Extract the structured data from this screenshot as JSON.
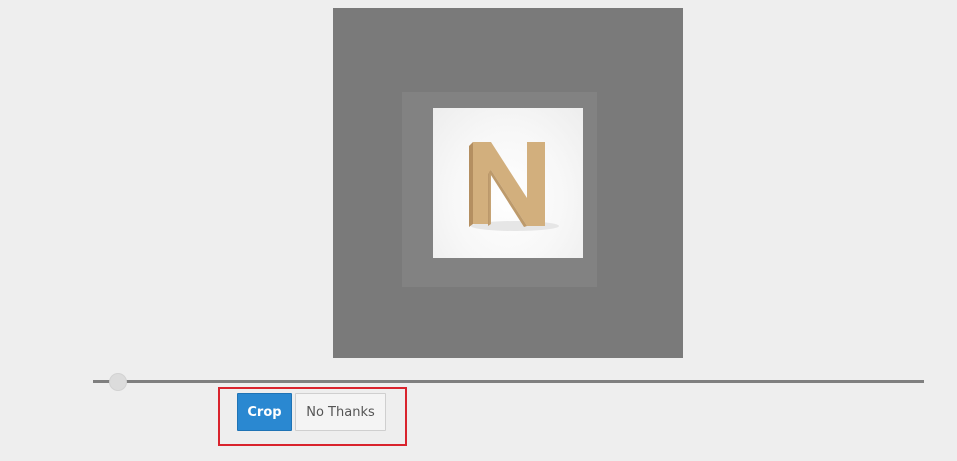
{
  "cropper": {
    "preview_letter": "N",
    "zoom": {
      "level": 0.03
    }
  },
  "actions": {
    "crop_label": "Crop",
    "cancel_label": "No Thanks"
  },
  "colors": {
    "primary": "#2a88d1",
    "highlight": "#d9232d",
    "letter": "#d2af7d",
    "canvas": "#7a7a7a"
  }
}
